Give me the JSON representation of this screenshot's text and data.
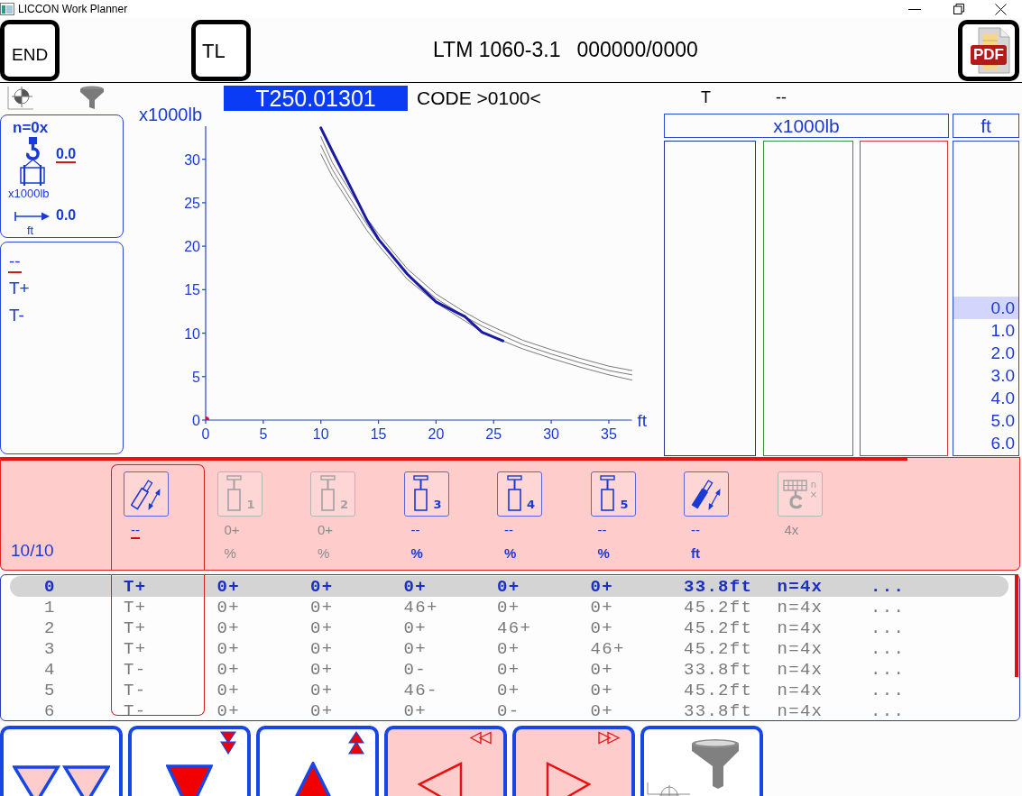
{
  "window": {
    "title": "LICCON Work Planner"
  },
  "toolbar": {
    "buttons": [
      {
        "label": "END",
        "kind": "exit"
      },
      {
        "label": "TL",
        "kind": "tool"
      }
    ],
    "model": "LTM 1060-3.1",
    "serial": "000000/0000",
    "export_button": {
      "label": "PDF"
    }
  },
  "info_bar": {
    "table_code": "T250.01301",
    "code": "CODE >0100<",
    "t_label": "T",
    "t_value": "--"
  },
  "load_panel": {
    "reeving": "n=0x",
    "load": {
      "value": "0.0",
      "selected": true
    },
    "load_unit": "x1000lb",
    "radius": {
      "value": "0.0",
      "selected": false
    },
    "radius_unit": "ft"
  },
  "telescoping_panel": {
    "items": [
      {
        "label": "--",
        "selected": true
      },
      {
        "label": "T+",
        "selected": false
      },
      {
        "label": "T-",
        "selected": false
      }
    ]
  },
  "load_chart": {
    "series_emphasis": [
      false,
      false,
      false,
      true
    ],
    "chart_data": {
      "type": "line",
      "xlabel": "ft",
      "ylabel": "x1000lb",
      "x": [
        10,
        11,
        12.5,
        14,
        15,
        17.5,
        20,
        22.5,
        24,
        25.8,
        27.5,
        30,
        32.5,
        35,
        37
      ],
      "series": [
        {
          "color": "#7a7a7a",
          "values": [
            32.6,
            29.6,
            26.4,
            23.2,
            21.4,
            17.4,
            14.5,
            12.4,
            11.3,
            10.2,
            9.2,
            8.1,
            7.1,
            6.2,
            5.7
          ]
        },
        {
          "color": "#7a7a7a",
          "values": [
            31.6,
            28.8,
            25.6,
            22.5,
            20.7,
            16.8,
            14.0,
            11.9,
            10.8,
            9.7,
            8.7,
            7.6,
            6.6,
            5.7,
            5.2
          ]
        },
        {
          "color": "#7a7a7a",
          "values": [
            30.6,
            28.0,
            24.9,
            21.8,
            20.1,
            16.2,
            13.5,
            11.4,
            10.2,
            9.1,
            8.2,
            7.1,
            6.1,
            5.2,
            4.6
          ]
        },
        {
          "color": "#1a1aa8",
          "values": [
            33.6,
            30.9,
            27.0,
            23.0,
            20.8,
            16.8,
            13.6,
            11.9,
            10.1,
            9.1,
            null,
            null,
            null,
            null,
            null
          ]
        }
      ],
      "xlim": [
        0,
        37
      ],
      "ylim": [
        0,
        33.8
      ],
      "xticks": [
        0,
        5,
        10,
        15,
        20,
        25,
        30,
        35
      ],
      "yticks": [
        0,
        5,
        10,
        15,
        20,
        25,
        30
      ]
    }
  },
  "load_bars": {
    "unit": "x1000lb",
    "columns": [
      {
        "color": "#24338f"
      },
      {
        "color": "#3d8f3d"
      },
      {
        "color": "#d03a3a"
      }
    ]
  },
  "radius_list": {
    "unit": "ft",
    "items": [
      {
        "label": "0.0",
        "selected": true
      },
      {
        "label": "1.0",
        "selected": false
      },
      {
        "label": "2.0",
        "selected": false
      },
      {
        "label": "3.0",
        "selected": false
      },
      {
        "label": "4.0",
        "selected": false
      },
      {
        "label": "5.0",
        "selected": false
      },
      {
        "label": "6.0",
        "selected": false
      }
    ]
  },
  "sections_strip": {
    "counter": "10/10",
    "progress": {
      "level": 0.89
    },
    "columns": [
      {
        "kind": "telescope",
        "enabled": true,
        "selected": true,
        "value": "--"
      },
      {
        "kind": "section",
        "badges": [
          "1"
        ],
        "enabled": false,
        "selected": false,
        "value": "0+",
        "unit": "%"
      },
      {
        "kind": "section",
        "badges": [
          "2"
        ],
        "enabled": false,
        "selected": false,
        "value": "0+",
        "unit": "%"
      },
      {
        "kind": "section",
        "badges": [
          "3"
        ],
        "enabled": true,
        "selected": false,
        "value": "--",
        "unit": "%"
      },
      {
        "kind": "section",
        "badges": [
          "4"
        ],
        "enabled": true,
        "selected": false,
        "value": "--",
        "unit": "%"
      },
      {
        "kind": "section",
        "badges": [
          "5"
        ],
        "enabled": true,
        "selected": false,
        "value": "--",
        "unit": "%"
      },
      {
        "kind": "boom",
        "enabled": true,
        "selected": false,
        "value": "--",
        "unit": "ft"
      },
      {
        "kind": "reeving",
        "badges": [
          "n",
          "×"
        ],
        "enabled": false,
        "selected": false,
        "value": "4x"
      }
    ]
  },
  "table": {
    "rows": [
      {
        "selected": true,
        "cells": [
          "0",
          "T+",
          "0+",
          "0+",
          "0+",
          "0+",
          "0+",
          "33.8ft",
          "n=4x",
          "..."
        ]
      },
      {
        "selected": false,
        "cells": [
          "1",
          "T+",
          "0+",
          "0+",
          "46+",
          "0+",
          "0+",
          "45.2ft",
          "n=4x",
          "..."
        ]
      },
      {
        "selected": false,
        "cells": [
          "2",
          "T+",
          "0+",
          "0+",
          "0+",
          "46+",
          "0+",
          "45.2ft",
          "n=4x",
          "..."
        ]
      },
      {
        "selected": false,
        "cells": [
          "3",
          "T+",
          "0+",
          "0+",
          "0+",
          "0+",
          "46+",
          "45.2ft",
          "n=4x",
          "..."
        ]
      },
      {
        "selected": false,
        "cells": [
          "4",
          "T-",
          "0+",
          "0+",
          "0-",
          "0+",
          "0+",
          "33.8ft",
          "n=4x",
          "..."
        ]
      },
      {
        "selected": false,
        "cells": [
          "5",
          "T-",
          "0+",
          "0+",
          "46-",
          "0+",
          "0+",
          "45.2ft",
          "n=4x",
          "..."
        ]
      },
      {
        "selected": false,
        "cells": [
          "6",
          "T-",
          "0+",
          "0+",
          "0+",
          "0-",
          "0+",
          "33.8ft",
          "n=4x",
          "..."
        ]
      }
    ]
  },
  "bottom_buttons": [
    {
      "kind": "lower-all",
      "active": false
    },
    {
      "kind": "lower",
      "active": false
    },
    {
      "kind": "raise",
      "active": false
    },
    {
      "kind": "previous",
      "active": true
    },
    {
      "kind": "next",
      "active": true
    },
    {
      "kind": "filter",
      "active": false
    }
  ]
}
